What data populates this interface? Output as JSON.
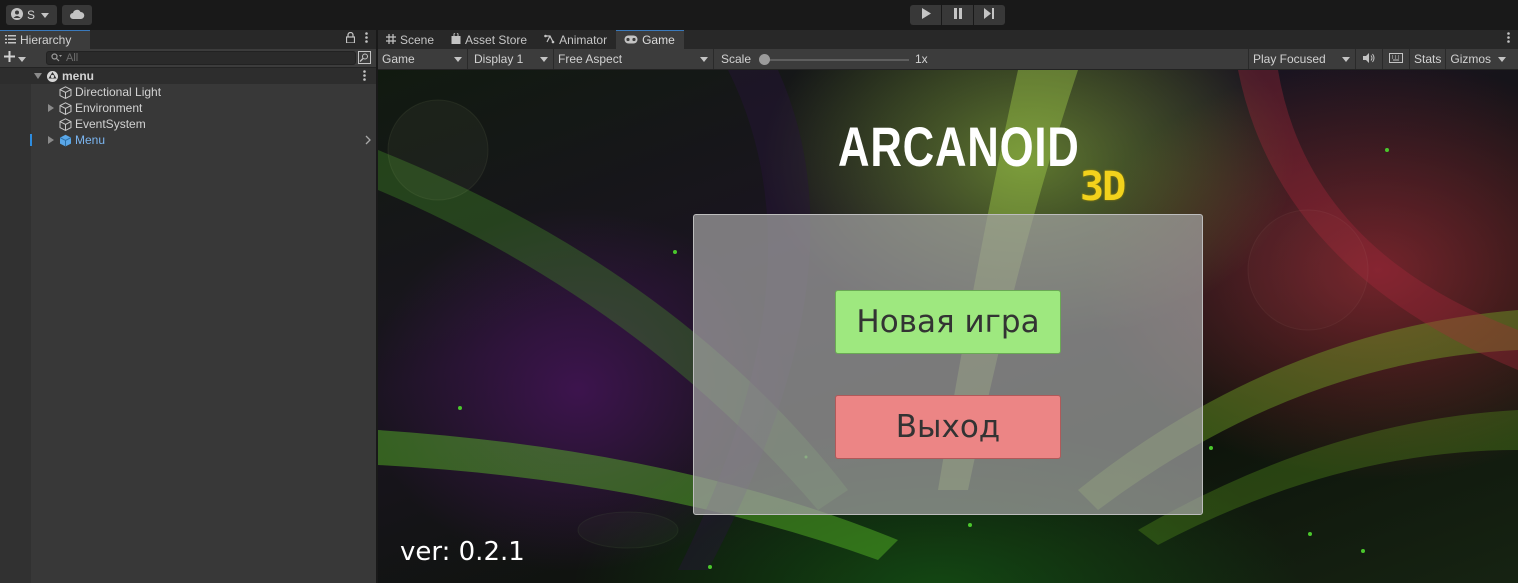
{
  "toolbar": {
    "account_label": "S",
    "account_icon": "account-icon",
    "cloud_icon": "cloud-icon",
    "play_icons": [
      "play-icon",
      "pause-icon",
      "step-icon"
    ]
  },
  "hierarchy": {
    "tab_label": "Hierarchy",
    "search_placeholder": "All",
    "root": {
      "name": "menu"
    },
    "items": [
      {
        "name": "Directional Light",
        "expandable": false
      },
      {
        "name": "Environment",
        "expandable": true
      },
      {
        "name": "EventSystem",
        "expandable": false
      },
      {
        "name": "Menu",
        "expandable": true,
        "prefab": true
      }
    ]
  },
  "dock": {
    "tabs": [
      {
        "label": "Scene",
        "icon": "grid-icon"
      },
      {
        "label": "Asset Store",
        "icon": "bag-icon"
      },
      {
        "label": "Animator",
        "icon": "animator-icon"
      },
      {
        "label": "Game",
        "icon": "gamepad-icon",
        "active": true
      }
    ]
  },
  "game_bar": {
    "view": "Game",
    "display": "Display 1",
    "aspect": "Free Aspect",
    "scale_label": "Scale",
    "scale_value": "1x",
    "scale_fraction": 0.0,
    "play_mode": "Play Focused",
    "stats": "Stats",
    "gizmos": "Gizmos"
  },
  "game": {
    "title": "ARCANOID",
    "title_suffix": "3D",
    "new_game": "Новая игра",
    "exit": "Выход",
    "version": "ver: 0.2.1"
  },
  "colors": {
    "accent": "#3a79bb",
    "new_game_button": "#9ee87f",
    "exit_button": "#ec8585",
    "title_suffix": "#f2d21c",
    "prefab_text": "#7bb5f0"
  }
}
